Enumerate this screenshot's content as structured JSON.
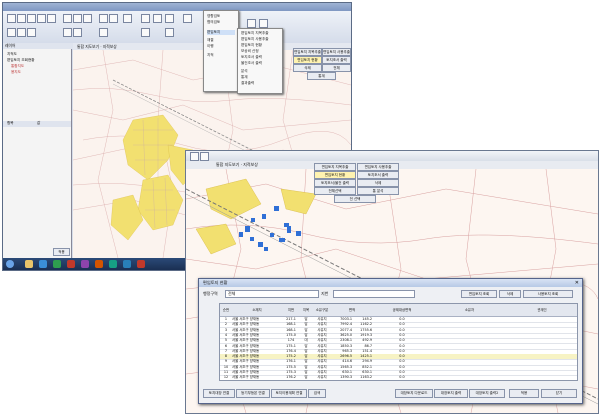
{
  "back_window": {
    "title": "",
    "map_tab_label": "통합 지도보기 · 지적보상",
    "left_panel_items": [
      "레이어",
      "지적도",
      "편입토지 조회현황",
      "통합지도",
      "용지도"
    ],
    "left_lower_header": [
      "항목",
      "값"
    ],
    "left_button_label": "적용",
    "dropdown_items": [
      "영향검토",
      "협의검토",
      "편입토지",
      "재결",
      "이행",
      "지적"
    ],
    "submenu_items": [
      "편입토지 지목추출",
      "편입토지 사용추출",
      "편입토지 현황",
      "보상비 산정",
      "토지조서 출력",
      "물건조서 출력",
      "분석",
      "통계",
      "결과출력"
    ],
    "side_buttons": [
      "편입토지 지목추출",
      "편입토지 사용추출",
      "편입토지 현황",
      "토지조서 출력",
      "삭제",
      "전체",
      "통계"
    ]
  },
  "front_map_window": {
    "tab_label": "통합 지도보기 · 지적보상",
    "side_buttons": [
      "편입토지 지목추출",
      "편입토지 사용추출",
      "편입토지 현황",
      "토지조서 출력",
      "토지조서/물건 출력",
      "삭제",
      "전체선택",
      "통 분석",
      "전 선택"
    ]
  },
  "dialog": {
    "title": "편입토지 현황",
    "filter_label": "행정구역",
    "filter_value": "전체",
    "filter_hint": "지번",
    "top_buttons": [
      "편입토지 조회",
      "삭제",
      "사용토지 조회"
    ],
    "columns": [
      "순번",
      "소재지",
      "지번",
      "지목",
      "소유구분",
      "면적",
      "공제대상면적",
      "소유자",
      "관계인"
    ],
    "rows": [
      {
        "no": "1",
        "addr": "서울 서초구 양재동",
        "jibun": "217-1",
        "jimok": "답",
        "own": "사유지",
        "area": "7003.1",
        "area2": "145.2",
        "v": "0.0"
      },
      {
        "no": "2",
        "addr": "서울 서초구 양재동",
        "jibun": "168-1",
        "jimok": "답",
        "own": "사유지",
        "area": "7992.4",
        "area2": "1162.2",
        "v": "0.0"
      },
      {
        "no": "3",
        "addr": "서울 서초구 양재동",
        "jibun": "168-1",
        "jimok": "답",
        "own": "사유지",
        "area": "2077.4",
        "area2": "1755.6",
        "v": "0.0"
      },
      {
        "no": "4",
        "addr": "서울 서초구 양재동",
        "jibun": "175-0",
        "jimok": "답",
        "own": "사유지",
        "area": "3625.0",
        "area2": "1919.3",
        "v": "0.0"
      },
      {
        "no": "5",
        "addr": "서울 서초구 양재동",
        "jibun": "174",
        "jimok": "대",
        "own": "사유지",
        "area": "2308.1",
        "area2": "492.9",
        "v": "0.0"
      },
      {
        "no": "6",
        "addr": "서울 서초구 양재동",
        "jibun": "175-1",
        "jimok": "답",
        "own": "사유지",
        "area": "1850.3",
        "area2": "86.7",
        "v": "0.0"
      },
      {
        "no": "7",
        "addr": "서울 서초구 양재동",
        "jibun": "176-4",
        "jimok": "답",
        "own": "사유지",
        "area": "965.3",
        "area2": "151.4",
        "v": "0.0"
      },
      {
        "no": "8",
        "addr": "서울 서초구 양재동",
        "jibun": "175-2",
        "jimok": "답",
        "own": "사유지",
        "area": "2696.5",
        "area2": "1425.1",
        "v": "0.0"
      },
      {
        "no": "9",
        "addr": "서울 서초구 양재동",
        "jibun": "176-1",
        "jimok": "답",
        "own": "사유지",
        "area": "414.6",
        "area2": "294.9",
        "v": "0.0"
      },
      {
        "no": "10",
        "addr": "서울 서초구 양재동",
        "jibun": "175-5",
        "jimok": "답",
        "own": "사유지",
        "area": "1565.3",
        "area2": "852.1",
        "v": "0.0"
      },
      {
        "no": "11",
        "addr": "서울 서초구 양재동",
        "jibun": "175-3",
        "jimok": "답",
        "own": "사유지",
        "area": "630.1",
        "area2": "630.1",
        "v": "0.0"
      },
      {
        "no": "12",
        "addr": "서울 서초구 양재동",
        "jibun": "176-2",
        "jimok": "답",
        "own": "사유지",
        "area": "1390.3",
        "area2": "1163.2",
        "v": "0.0"
      },
      {
        "no": "13",
        "addr": "서울 서초구 양재동",
        "jibun": "177-0",
        "jimok": "답",
        "own": "사유지",
        "area": "1823.6",
        "area2": "579.4",
        "v": "0.0"
      },
      {
        "no": "14",
        "addr": "서울 서초구 양재동",
        "jibun": "178-1",
        "jimok": "답",
        "own": "사유지",
        "area": "1045.9",
        "area2": "1.2",
        "v": "0.0"
      }
    ],
    "selected_row_index": 7,
    "bottom_buttons_left": [
      "토지대장 연결",
      "등기부등본 연결",
      "토지이용계획 연결",
      "검색"
    ],
    "bottom_buttons_right": [
      "대장토지 다운로드",
      "대장토지 출력",
      "대장토지 출력2",
      "적용",
      "닫기"
    ]
  },
  "colors": {
    "window_blue": "#7f97c2",
    "taskbar": "#1a2f52",
    "selection": "#f7f3c4",
    "parcel_blue": "#2f6fd6",
    "map_yellow": "#f2e070"
  }
}
